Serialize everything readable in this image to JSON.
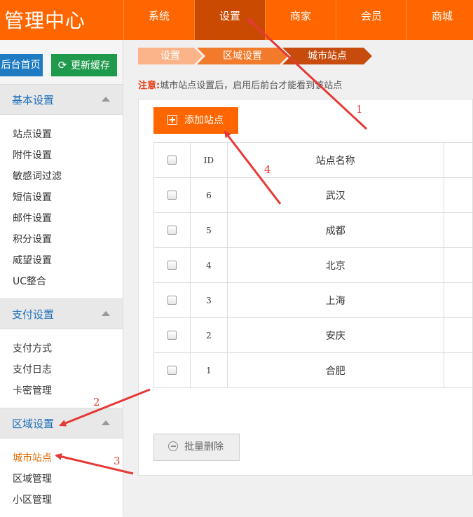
{
  "header": {
    "logo": "管理中心",
    "nav": [
      "系统",
      "设置",
      "商家",
      "会员",
      "商城"
    ]
  },
  "sidebar": {
    "home_button": "后台首页",
    "cache_button": "更新缓存",
    "groups": [
      {
        "title": "基本设置",
        "items": [
          "站点设置",
          "附件设置",
          "敏感词过滤",
          "短信设置",
          "邮件设置",
          "积分设置",
          "威望设置",
          "UC整合"
        ]
      },
      {
        "title": "支付设置",
        "items": [
          "支付方式",
          "支付日志",
          "卡密管理"
        ]
      },
      {
        "title": "区域设置",
        "items": [
          "城市站点",
          "区域管理",
          "小区管理"
        ]
      }
    ]
  },
  "breadcrumb": [
    "设置",
    "区域设置",
    "城市站点"
  ],
  "notice": {
    "label": "注意:",
    "text": "城市站点设置后，启用后前台才能看到该站点"
  },
  "add_button": "添加站点",
  "table": {
    "headers": [
      "",
      "ID",
      "站点名称"
    ],
    "rows": [
      {
        "id": "6",
        "name": "武汉"
      },
      {
        "id": "5",
        "name": "成都"
      },
      {
        "id": "4",
        "name": "北京"
      },
      {
        "id": "3",
        "name": "上海"
      },
      {
        "id": "2",
        "name": "安庆"
      },
      {
        "id": "1",
        "name": "合肥"
      }
    ]
  },
  "bulk_delete_button": "批量删除",
  "annotations": [
    "1",
    "2",
    "3",
    "4"
  ],
  "colors": {
    "brand": "#ff6600",
    "nav_active": "#c94a00",
    "link": "#1e6fb8",
    "annotation": "#e53935"
  }
}
